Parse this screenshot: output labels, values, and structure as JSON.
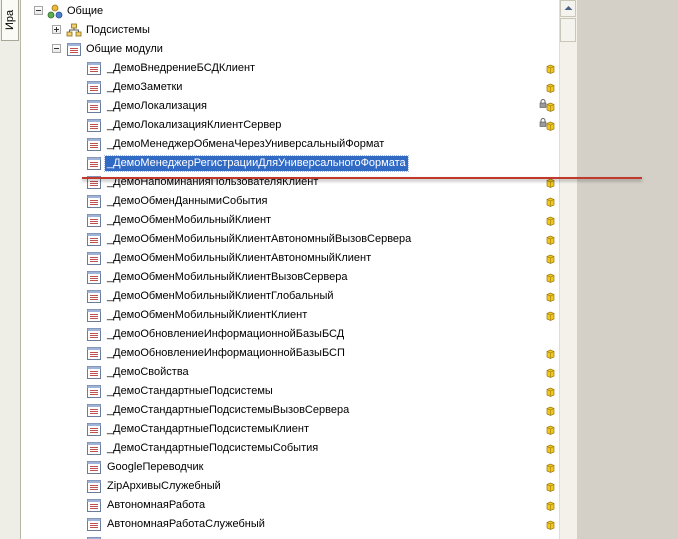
{
  "left_panel": {
    "tab_label": "Ира"
  },
  "tree": {
    "root": {
      "label": "Общие"
    },
    "subsystems": {
      "label": "Подсистемы"
    },
    "common_modules": {
      "label": "Общие модули"
    },
    "modules": [
      {
        "label": "_ДемоВнедрениеБСДКлиент",
        "badge": true,
        "lock": false,
        "selected": false
      },
      {
        "label": "_ДемоЗаметки",
        "badge": true,
        "lock": false,
        "selected": false
      },
      {
        "label": "_ДемоЛокализация",
        "badge": true,
        "lock": true,
        "selected": false
      },
      {
        "label": "_ДемоЛокализацияКлиентСервер",
        "badge": true,
        "lock": true,
        "selected": false
      },
      {
        "label": "_ДемоМенеджерОбменаЧерезУниверсальныйФормат",
        "badge": false,
        "lock": false,
        "selected": false
      },
      {
        "label": "_ДемоМенеджерРегистрацииДляУниверсальногоФормата",
        "badge": false,
        "lock": false,
        "selected": true
      },
      {
        "label": "_ДемоНапоминанияПользователяКлиент",
        "badge": true,
        "lock": false,
        "selected": false
      },
      {
        "label": "_ДемоОбменДаннымиСобытия",
        "badge": true,
        "lock": false,
        "selected": false
      },
      {
        "label": "_ДемоОбменМобильныйКлиент",
        "badge": true,
        "lock": false,
        "selected": false
      },
      {
        "label": "_ДемоОбменМобильныйКлиентАвтономныйВызовСервера",
        "badge": true,
        "lock": false,
        "selected": false
      },
      {
        "label": "_ДемоОбменМобильныйКлиентАвтономныйКлиент",
        "badge": true,
        "lock": false,
        "selected": false
      },
      {
        "label": "_ДемоОбменМобильныйКлиентВызовСервера",
        "badge": true,
        "lock": false,
        "selected": false
      },
      {
        "label": "_ДемоОбменМобильныйКлиентГлобальный",
        "badge": true,
        "lock": false,
        "selected": false
      },
      {
        "label": "_ДемоОбменМобильныйКлиентКлиент",
        "badge": true,
        "lock": false,
        "selected": false
      },
      {
        "label": "_ДемоОбновлениеИнформационнойБазыБСД",
        "badge": false,
        "lock": false,
        "selected": false
      },
      {
        "label": "_ДемоОбновлениеИнформационнойБазыБСП",
        "badge": true,
        "lock": false,
        "selected": false
      },
      {
        "label": "_ДемоСвойства",
        "badge": true,
        "lock": false,
        "selected": false
      },
      {
        "label": "_ДемоСтандартныеПодсистемы",
        "badge": true,
        "lock": false,
        "selected": false
      },
      {
        "label": "_ДемоСтандартныеПодсистемыВызовСервера",
        "badge": true,
        "lock": false,
        "selected": false
      },
      {
        "label": "_ДемоСтандартныеПодсистемыКлиент",
        "badge": true,
        "lock": false,
        "selected": false
      },
      {
        "label": "_ДемоСтандартныеПодсистемыСобытия",
        "badge": true,
        "lock": false,
        "selected": false
      },
      {
        "label": "GoogleПереводчик",
        "badge": true,
        "lock": false,
        "selected": false
      },
      {
        "label": "ZipАрхивыСлужебный",
        "badge": true,
        "lock": false,
        "selected": false
      },
      {
        "label": "АвтономнаяРабота",
        "badge": true,
        "lock": false,
        "selected": false
      },
      {
        "label": "АвтономнаяРаботаСлужебный",
        "badge": true,
        "lock": false,
        "selected": false
      },
      {
        "label": "",
        "badge": false,
        "lock": false,
        "selected": false
      }
    ]
  },
  "colors": {
    "selection": "#316ac5",
    "drop_indicator": "#c0392b",
    "badge_yellow": "#f2c81c"
  },
  "icons": {
    "root": "common-group-icon",
    "subsystems": "subsystems-icon",
    "module": "common-module-icon",
    "badge": "support-status-icon",
    "lock": "lock-icon"
  }
}
